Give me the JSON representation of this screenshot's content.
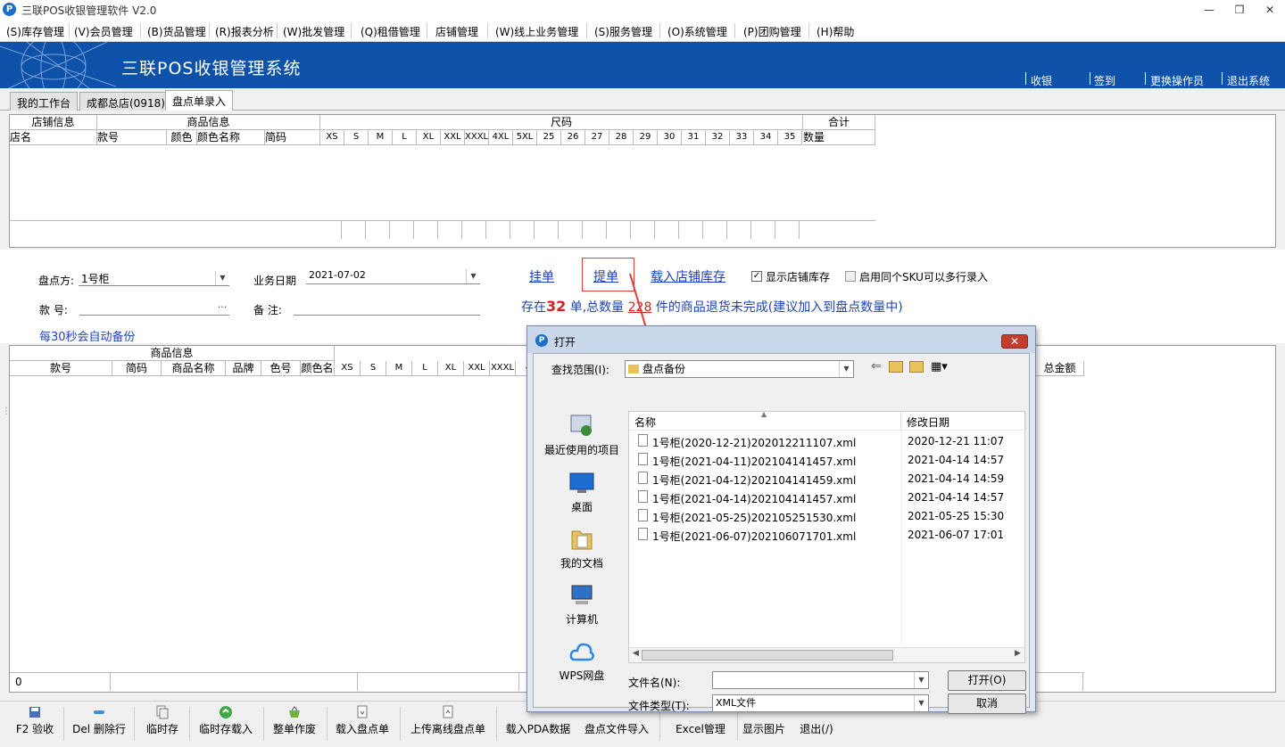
{
  "window": {
    "title": "三联POS收银管理软件 V2.0",
    "controls": {
      "minimize": "—",
      "restore": "❐",
      "close": "✕"
    }
  },
  "menu": [
    "(S)库存管理",
    "(V)会员管理",
    "(B)货品管理",
    "(R)报表分析",
    "(W)批发管理",
    "(Q)租借管理",
    "店铺管理",
    "(W)线上业务管理",
    "(S)服务管理",
    "(O)系统管理",
    "(P)团购管理",
    "(H)帮助"
  ],
  "banner": {
    "system_name": "三联POS收银管理系统",
    "actions": [
      "收银",
      "签到",
      "更换操作员",
      "退出系统"
    ]
  },
  "tabs": [
    "我的工作台",
    "成都总店(0918)",
    "盘点单录入"
  ],
  "grid_top": {
    "groups": [
      "店铺信息",
      "商品信息",
      "尺码",
      "合计"
    ],
    "columns": [
      "店名",
      "款号",
      "颜色",
      "颜色名称",
      "简码"
    ],
    "sizes": [
      "XS",
      "S",
      "M",
      "L",
      "XL",
      "XXL",
      "XXXL",
      "4XL",
      "5XL",
      "25",
      "26",
      "27",
      "28",
      "29",
      "30",
      "31",
      "32",
      "33",
      "34",
      "35"
    ],
    "total_column": "数量"
  },
  "form": {
    "inventory_party_label": "盘点方:",
    "inventory_party_value": "1号柜",
    "business_date_label": "业务日期",
    "business_date_value": "2021-07-02",
    "style_no_label": "款 号:",
    "style_no_value": "",
    "remark_label": "备 注:",
    "remark_value": "",
    "autosave_note": "每30秒会自动备份",
    "links": [
      "挂单",
      "提单",
      "载入店铺库存"
    ],
    "show_store_stock_label": "显示店铺库存",
    "show_store_stock_checked": true,
    "allow_multi_sku_label": "启用同个SKU可以多行录入",
    "allow_multi_sku_checked": false,
    "notice_prefix": "存在",
    "notice_count": "32",
    "notice_mid": "单,总数量",
    "notice_qty": "228",
    "notice_suffix": "件的商品退货未完成(建议加入到盘点数量中)"
  },
  "grid_bottom": {
    "group": "商品信息",
    "columns": [
      "款号",
      "简码",
      "商品名称",
      "品牌",
      "色号",
      "颜色名"
    ],
    "sizes": [
      "XS",
      "S",
      "M",
      "L",
      "XL",
      "XXL",
      "XXXL",
      "4"
    ],
    "right_column": "总金额",
    "footer_value": "0"
  },
  "toolbar": [
    "F2 验收",
    "Del 删除行",
    "临时存",
    "临时存载入",
    "整单作废",
    "载入盘点单",
    "上传离线盘点单",
    "载入PDA数据",
    "盘点文件导入",
    "Excel管理",
    "显示图片",
    "退出(/)"
  ],
  "dialog": {
    "title": "打开",
    "lookin_label": "查找范围(I):",
    "lookin_value": "盘点备份",
    "places": [
      "最近使用的项目",
      "桌面",
      "我的文档",
      "计算机",
      "WPS网盘"
    ],
    "columns": {
      "name": "名称",
      "modified": "修改日期"
    },
    "files": [
      {
        "name": "1号柜(2020-12-21)202012211107.xml",
        "date": "2020-12-21 11:07"
      },
      {
        "name": "1号柜(2021-04-11)202104141457.xml",
        "date": "2021-04-14 14:57"
      },
      {
        "name": "1号柜(2021-04-12)202104141459.xml",
        "date": "2021-04-14 14:59"
      },
      {
        "name": "1号柜(2021-04-14)202104141457.xml",
        "date": "2021-04-14 14:57"
      },
      {
        "name": "1号柜(2021-05-25)202105251530.xml",
        "date": "2021-05-25 15:30"
      },
      {
        "name": "1号柜(2021-06-07)202106071701.xml",
        "date": "2021-06-07 17:01"
      }
    ],
    "filename_label": "文件名(N):",
    "filename_value": "",
    "filetype_label": "文件类型(T):",
    "filetype_value": "XML文件",
    "open_button": "打开(O)",
    "cancel_button": "取消"
  }
}
